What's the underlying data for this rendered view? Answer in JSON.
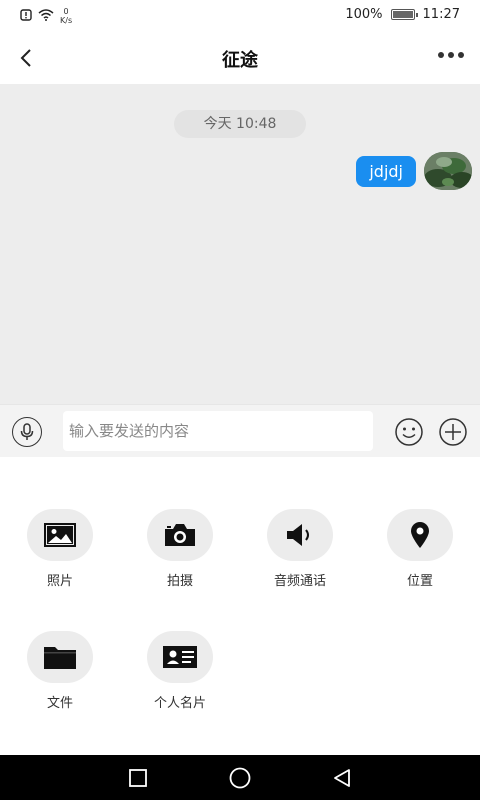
{
  "status_bar": {
    "speed_value": "0",
    "speed_unit": "K/s",
    "battery_percent": "100%",
    "time": "11:27"
  },
  "header": {
    "title": "征途"
  },
  "chat": {
    "timestamp": "今天 10:48",
    "messages": [
      {
        "text": "jdjdj",
        "sender": "me"
      }
    ]
  },
  "input": {
    "placeholder": "输入要发送的内容",
    "value": ""
  },
  "panel": {
    "tools": [
      {
        "label": "照片",
        "icon": "image-icon"
      },
      {
        "label": "拍摄",
        "icon": "camera-icon"
      },
      {
        "label": "音频通话",
        "icon": "speaker-icon"
      },
      {
        "label": "位置",
        "icon": "location-pin-icon"
      },
      {
        "label": "文件",
        "icon": "folder-icon"
      },
      {
        "label": "个人名片",
        "icon": "contact-card-icon"
      }
    ]
  },
  "colors": {
    "bubble": "#1a8ef0",
    "chat_background": "#ededed",
    "tool_circle": "#ececec"
  }
}
